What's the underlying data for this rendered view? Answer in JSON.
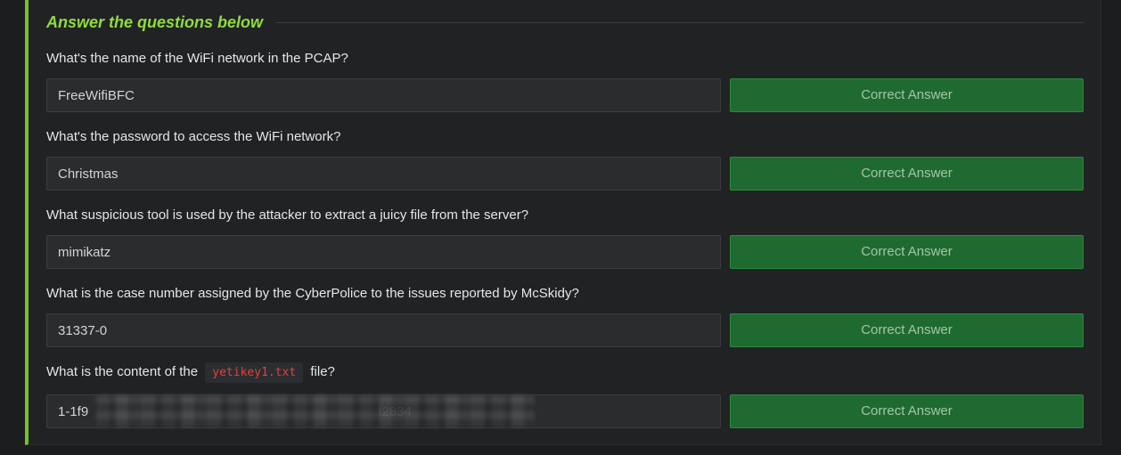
{
  "section": {
    "title": "Answer the questions below"
  },
  "questions": [
    {
      "label": "What's the name of the WiFi network in the PCAP?",
      "answer": "FreeWifiBFC",
      "button": "Correct Answer"
    },
    {
      "label": "What's the password to access the WiFi network?",
      "answer": "Christmas",
      "button": "Correct Answer"
    },
    {
      "label": "What suspicious tool is used by the attacker to extract a juicy file from the server?",
      "answer": "mimikatz",
      "button": "Correct Answer"
    },
    {
      "label": "What is the case number assigned by the CyberPolice to the issues reported by McSkidy?",
      "answer": "31337-0",
      "button": "Correct Answer"
    },
    {
      "label_prefix": "What is the content of the",
      "label_code": "yetikey1.txt",
      "label_suffix": "file?",
      "answer": "1-1f9                                                                              f2834",
      "button": "Correct Answer"
    }
  ],
  "colors": {
    "accent_green": "#8fdc3c",
    "button_green": "#1f6a30",
    "code_red": "#e3413f"
  }
}
